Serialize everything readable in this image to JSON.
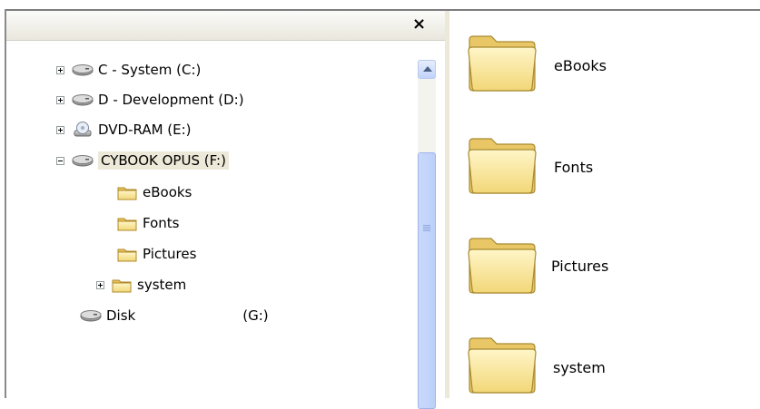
{
  "tree": {
    "close_label": "×",
    "items": [
      {
        "label": "C - System (C:)"
      },
      {
        "label": "D - Development (D:)"
      },
      {
        "label": "DVD-RAM (E:)"
      },
      {
        "label": "CYBOOK OPUS (F:)"
      },
      {
        "label": "eBooks"
      },
      {
        "label": "Fonts"
      },
      {
        "label": "Pictures"
      },
      {
        "label": "system"
      },
      {
        "label": "Disk",
        "suffix": "(G:)"
      }
    ]
  },
  "folders": [
    {
      "label": "eBooks"
    },
    {
      "label": "Fonts"
    },
    {
      "label": "Pictures"
    },
    {
      "label": "system"
    }
  ]
}
